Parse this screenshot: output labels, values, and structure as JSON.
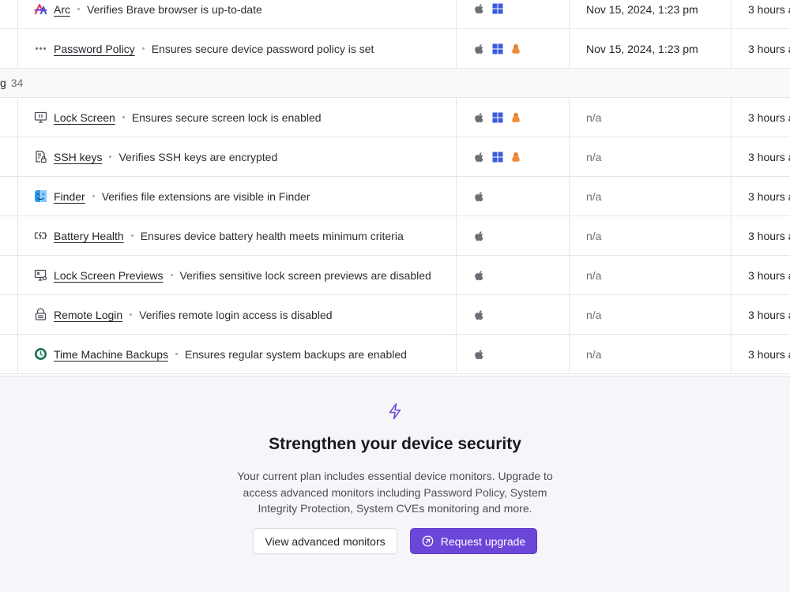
{
  "monitors_top": [
    {
      "icon": "arc-logo-icon",
      "name": "Arc",
      "description": "Verifies Brave browser is up-to-date",
      "os": [
        "apple",
        "windows"
      ],
      "last_run": "Nov 15, 2024, 1:23 pm",
      "updated": "3 hours a"
    },
    {
      "icon": "more-dots-icon",
      "name": "Password Policy",
      "description": "Ensures secure device password policy is set",
      "os": [
        "apple",
        "windows",
        "linux"
      ],
      "last_run": "Nov 15, 2024, 1:23 pm",
      "updated": "3 hours a"
    }
  ],
  "group": {
    "label": "g",
    "count": "34"
  },
  "monitors_group": [
    {
      "icon": "monitor-icon",
      "name": "Lock Screen",
      "description": "Ensures secure screen lock is enabled",
      "os": [
        "apple",
        "windows",
        "linux"
      ],
      "last_run": "n/a",
      "updated": "3 hours a"
    },
    {
      "icon": "key-file-icon",
      "name": "SSH keys",
      "description": "Verifies SSH keys are encrypted",
      "os": [
        "apple",
        "windows",
        "linux"
      ],
      "last_run": "n/a",
      "updated": "3 hours a"
    },
    {
      "icon": "finder-icon",
      "name": "Finder",
      "description": "Verifies file extensions are visible in Finder",
      "os": [
        "apple"
      ],
      "last_run": "n/a",
      "updated": "3 hours a"
    },
    {
      "icon": "battery-icon",
      "name": "Battery Health",
      "description": "Ensures device battery health meets minimum criteria",
      "os": [
        "apple"
      ],
      "last_run": "n/a",
      "updated": "3 hours a"
    },
    {
      "icon": "screen-preview-icon",
      "name": "Lock Screen Previews",
      "description": "Verifies sensitive lock screen previews are disabled",
      "os": [
        "apple"
      ],
      "last_run": "n/a",
      "updated": "3 hours a"
    },
    {
      "icon": "remote-login-icon",
      "name": "Remote Login",
      "description": "Verifies remote login access is disabled",
      "os": [
        "apple"
      ],
      "last_run": "n/a",
      "updated": "3 hours a"
    },
    {
      "icon": "time-machine-icon",
      "name": "Time Machine Backups",
      "description": "Ensures regular system backups are enabled",
      "os": [
        "apple"
      ],
      "last_run": "n/a",
      "updated": "3 hours a"
    }
  ],
  "upsell": {
    "icon": "lightning-bolt-icon",
    "title": "Strengthen your device security",
    "body": "Your current plan includes essential device monitors. Upgrade to access advanced monitors including Password Policy, System Integrity Protection, System CVEs monitoring and more.",
    "secondary_label": "View advanced monitors",
    "primary_label": "Request upgrade",
    "primary_icon": "arrow-circle-icon"
  },
  "colors": {
    "accent": "#6b46d8",
    "windows_blue": "#3b5bdb",
    "linux_orange": "#f08c3a",
    "apple_gray": "#6b6f76"
  }
}
